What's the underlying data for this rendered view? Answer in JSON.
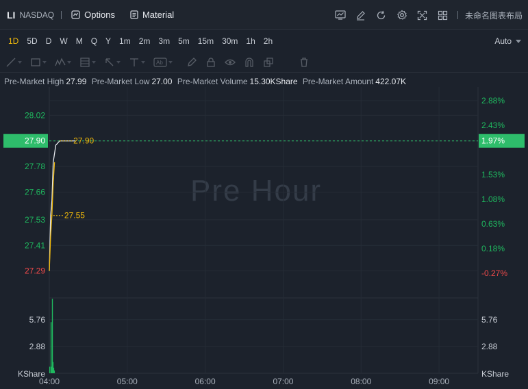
{
  "header": {
    "symbol": "LI",
    "exchange": "NASDAQ",
    "options_label": "Options",
    "material_label": "Material",
    "layout_name": "未命名图表布局",
    "icons": [
      "chart-indicator-icon",
      "draw-edit-icon",
      "refresh-icon",
      "gear-icon",
      "fullscreen-icon",
      "grid-layout-icon"
    ]
  },
  "timeframes": {
    "items": [
      "1D",
      "5D",
      "D",
      "W",
      "M",
      "Q",
      "Y",
      "1m",
      "2m",
      "3m",
      "5m",
      "15m",
      "30m",
      "1h",
      "2h"
    ],
    "active": "1D",
    "scale_mode": "Auto"
  },
  "drawing_tools": [
    "trend-line-icon",
    "rectangle-icon",
    "pattern-icon",
    "fib-icon",
    "arrow-icon",
    "horizontal-line-icon",
    "text-icon",
    "brush-icon",
    "lock-icon",
    "eye-icon",
    "magnet-icon",
    "cursor-icon",
    "trash-icon"
  ],
  "info": {
    "high_label": "Pre-Market High",
    "high_value": "27.99",
    "low_label": "Pre-Market Low",
    "low_value": "27.00",
    "volume_label": "Pre-Market Volume",
    "volume_value": "15.30KShare",
    "amount_label": "Pre-Market Amount",
    "amount_value": "422.07K"
  },
  "watermark": "Pre Hour",
  "colors": {
    "up": "#1fb95f",
    "down": "#f04a4a",
    "current": "#2ebd6b",
    "avg_line": "#f0b90b",
    "price_line": "#e6e9ee"
  },
  "chart_data": {
    "type": "line",
    "price_axis": {
      "ticks": [
        "28.02",
        "27.90",
        "27.78",
        "27.66",
        "27.53",
        "27.41",
        "27.29"
      ],
      "ylim": [
        27.17,
        28.14
      ]
    },
    "percent_axis": {
      "ticks": [
        "2.88%",
        "2.43%",
        "1.97%",
        "1.53%",
        "1.08%",
        "0.63%",
        "0.18%",
        "-0.27%"
      ]
    },
    "volume_axis": {
      "ticks": [
        "5.76",
        "2.88"
      ],
      "unit": "KShare",
      "ylim": [
        0,
        8.1
      ]
    },
    "x_ticks": [
      "04:00",
      "05:00",
      "06:00",
      "07:00",
      "08:00",
      "09:00"
    ],
    "x_range": [
      0,
      330
    ],
    "current_price": "27.90",
    "current_percent": "1.97%",
    "series": [
      {
        "name": "price",
        "x": [
          0,
          1,
          2,
          3,
          5,
          8,
          12,
          20
        ],
        "y": [
          27.29,
          27.55,
          27.62,
          27.8,
          27.88,
          27.9,
          27.9,
          27.9
        ]
      },
      {
        "name": "avg",
        "x": [
          0,
          1,
          2,
          3,
          4
        ],
        "y": [
          27.29,
          27.45,
          27.55,
          27.7,
          27.8
        ]
      }
    ],
    "labels": [
      {
        "text": "27.90",
        "y": 27.9
      },
      {
        "text": "27.55",
        "y": 27.55
      }
    ],
    "volume": {
      "x": [
        0,
        1,
        1.5,
        2,
        2.5,
        3,
        3.5
      ],
      "values": [
        0.7,
        5.5,
        0.7,
        8.0,
        1.2,
        0.6,
        0.3
      ]
    }
  }
}
